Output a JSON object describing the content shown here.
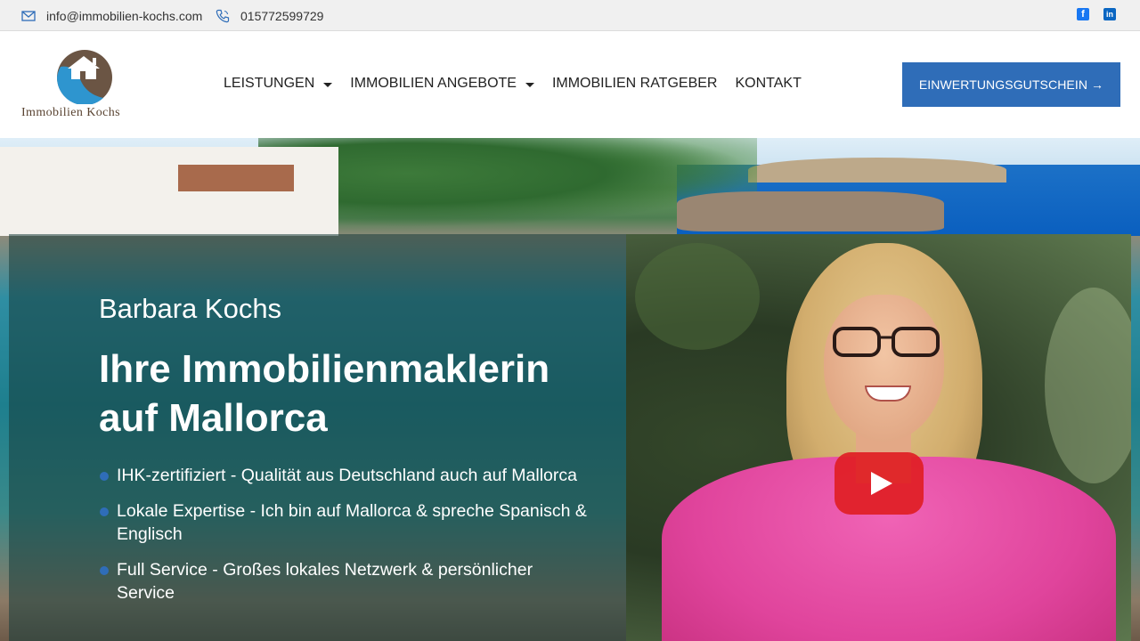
{
  "topbar": {
    "email": "info@immobilien-kochs.com",
    "phone": "015772599729",
    "email_icon": "mail-icon",
    "phone_icon": "phone-icon",
    "social": [
      {
        "name": "facebook-icon",
        "glyph": "f",
        "color": "#1877f2"
      },
      {
        "name": "linkedin-icon",
        "glyph": "in",
        "color": "#0a66c2"
      }
    ]
  },
  "header": {
    "logo_text": "Immobilien Kochs",
    "nav": [
      {
        "label": "LEISTUNGEN",
        "dropdown": true
      },
      {
        "label": "IMMOBILIEN ANGEBOTE",
        "dropdown": true
      },
      {
        "label": "IMMOBILIEN RATGEBER",
        "dropdown": false
      },
      {
        "label": "KONTAKT",
        "dropdown": false
      }
    ],
    "cta_label": "EINWERTUNGSGUTSCHEIN →",
    "cta_color": "#2f6db8"
  },
  "hero": {
    "name": "Barbara Kochs",
    "title": "Ihre Immobilienmaklerin auf Mallorca",
    "bullets": [
      "IHK-zertifiziert - Qualität aus Deutschland auch auf Mallorca",
      "Lokale Expertise - Ich bin auf Mallorca & spreche Spanisch & Englisch",
      "Full Service - Großes lokales Netzwerk & persönlicher Service"
    ],
    "bullet_color": "#2f6db8",
    "video": {
      "play_icon": "play-icon",
      "play_color": "#df1e24"
    }
  }
}
